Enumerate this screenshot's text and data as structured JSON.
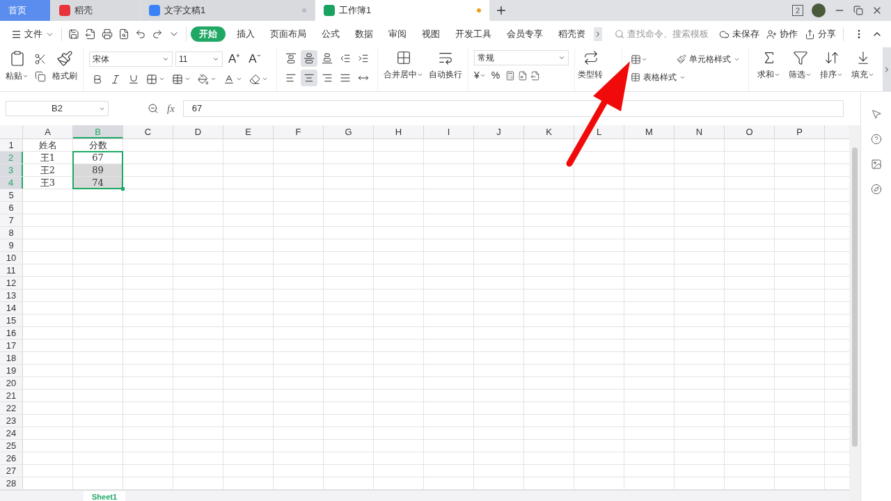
{
  "tabs": [
    {
      "label": "首页",
      "kind": "home",
      "selected": false
    },
    {
      "label": "稻壳",
      "kind": "app",
      "selected": false
    },
    {
      "label": "文字文稿1",
      "kind": "doc",
      "selected": false,
      "modified": false
    },
    {
      "label": "工作簿1",
      "kind": "sheet",
      "selected": true,
      "modified": true
    }
  ],
  "window": {
    "badge": "2"
  },
  "menu": {
    "file": "文件",
    "tabs": [
      {
        "label": "开始",
        "selected": true
      },
      {
        "label": "插入",
        "selected": false
      },
      {
        "label": "页面布局",
        "selected": false
      },
      {
        "label": "公式",
        "selected": false
      },
      {
        "label": "数据",
        "selected": false
      },
      {
        "label": "审阅",
        "selected": false
      },
      {
        "label": "视图",
        "selected": false
      },
      {
        "label": "开发工具",
        "selected": false
      },
      {
        "label": "会员专享",
        "selected": false
      },
      {
        "label": "稻壳资",
        "selected": false
      }
    ],
    "search": {
      "placeholder": "查找命令、搜索模板"
    },
    "actions": [
      "未保存",
      "协作",
      "分享"
    ]
  },
  "ribbon": {
    "paste": "粘贴",
    "format_painter": "格式刷",
    "font": "宋体",
    "size": "11",
    "size_buttons": [
      "A⁺",
      "A⁻"
    ],
    "align_top": [
      {
        "kind": "top",
        "selected": false
      },
      {
        "kind": "middle",
        "selected": true
      },
      {
        "kind": "bottom",
        "selected": false
      },
      {
        "kind": "outdent",
        "selected": false
      },
      {
        "kind": "indent",
        "selected": false
      }
    ],
    "align_bottom": [
      {
        "kind": "left",
        "selected": false
      },
      {
        "kind": "center",
        "selected": true
      },
      {
        "kind": "right",
        "selected": false
      },
      {
        "kind": "justify",
        "selected": false
      },
      {
        "kind": "distribute",
        "selected": false
      }
    ],
    "merge": "合并居中",
    "wrap": "自动换行",
    "number_format": "常规",
    "currency": "¥",
    "percent": "%",
    "convert": "类型转",
    "cell_style": "单元格样式",
    "table_style": "表格样式",
    "tools": [
      {
        "label": "求和",
        "kind": "sum"
      },
      {
        "label": "筛选",
        "kind": "filter"
      },
      {
        "label": "排序",
        "kind": "sort"
      },
      {
        "label": "填充",
        "kind": "fill"
      }
    ]
  },
  "formula_bar": {
    "name_box": "B2",
    "fx": "fx",
    "value": "67"
  },
  "sheet": {
    "columns": [
      {
        "label": "A",
        "selected": false
      },
      {
        "label": "B",
        "selected": true
      },
      {
        "label": "C",
        "selected": false
      },
      {
        "label": "D",
        "selected": false
      },
      {
        "label": "E",
        "selected": false
      },
      {
        "label": "F",
        "selected": false
      },
      {
        "label": "G",
        "selected": false
      },
      {
        "label": "H",
        "selected": false
      },
      {
        "label": "I",
        "selected": false
      },
      {
        "label": "J",
        "selected": false
      },
      {
        "label": "K",
        "selected": false
      },
      {
        "label": "L",
        "selected": false
      },
      {
        "label": "M",
        "selected": false
      },
      {
        "label": "N",
        "selected": false
      },
      {
        "label": "O",
        "selected": false
      },
      {
        "label": "P",
        "selected": false
      }
    ],
    "rows": [
      {
        "label": "1",
        "selected": false,
        "cells": [
          {
            "text": "姓名",
            "selected": false
          },
          {
            "text": "分数",
            "selected": false
          }
        ]
      },
      {
        "label": "2",
        "selected": true,
        "cells": [
          {
            "text": "王1",
            "selected": false
          },
          {
            "text": "67",
            "selected": false,
            "active": true
          }
        ]
      },
      {
        "label": "3",
        "selected": true,
        "cells": [
          {
            "text": "王2",
            "selected": false
          },
          {
            "text": "89",
            "selected": true
          }
        ]
      },
      {
        "label": "4",
        "selected": true,
        "cells": [
          {
            "text": "王3",
            "selected": false
          },
          {
            "text": "74",
            "selected": true
          }
        ]
      },
      {
        "label": "5",
        "selected": false
      },
      {
        "label": "6",
        "selected": false
      },
      {
        "label": "7",
        "selected": false
      },
      {
        "label": "8",
        "selected": false
      },
      {
        "label": "9",
        "selected": false
      },
      {
        "label": "10",
        "selected": false
      },
      {
        "label": "11",
        "selected": false
      },
      {
        "label": "12",
        "selected": false
      },
      {
        "label": "13",
        "selected": false
      },
      {
        "label": "14",
        "selected": false
      },
      {
        "label": "15",
        "selected": false
      },
      {
        "label": "16",
        "selected": false
      },
      {
        "label": "17",
        "selected": false
      },
      {
        "label": "18",
        "selected": false
      },
      {
        "label": "19",
        "selected": false
      },
      {
        "label": "20",
        "selected": false
      },
      {
        "label": "21",
        "selected": false
      },
      {
        "label": "22",
        "selected": false
      },
      {
        "label": "23",
        "selected": false
      },
      {
        "label": "24",
        "selected": false
      },
      {
        "label": "25",
        "selected": false
      },
      {
        "label": "26",
        "selected": false
      },
      {
        "label": "27",
        "selected": false
      },
      {
        "label": "28",
        "selected": false
      }
    ],
    "sheet_tab": "Sheet1"
  }
}
